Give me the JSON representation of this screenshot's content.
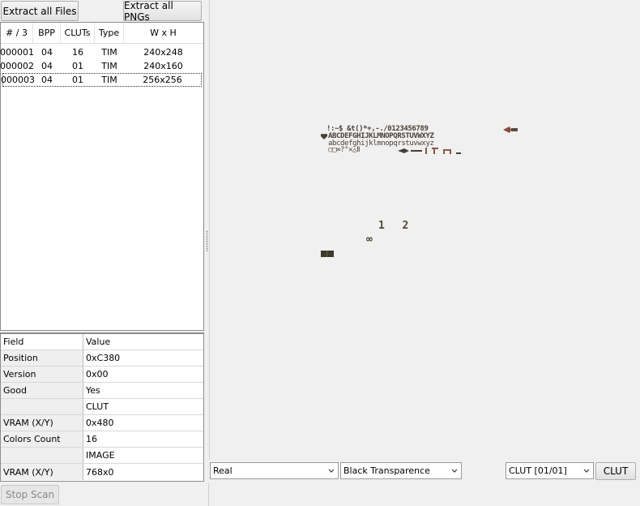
{
  "toolbar": {
    "extract_all_files": "Extract all Files",
    "extract_all_pngs": "Extract all PNGs"
  },
  "file_table": {
    "headers": [
      "# / 3",
      "BPP",
      "CLUTs",
      "Type",
      "W x H"
    ],
    "rows": [
      {
        "id": "000001",
        "bpp": "04",
        "cluts": "16",
        "type": "TIM",
        "size": "240x248"
      },
      {
        "id": "000002",
        "bpp": "04",
        "cluts": "01",
        "type": "TIM",
        "size": "240x160"
      },
      {
        "id": "000003",
        "bpp": "04",
        "cluts": "01",
        "type": "TIM",
        "size": "256x256"
      }
    ],
    "selected_row": 2
  },
  "properties": {
    "headers": [
      "Field",
      "Value"
    ],
    "rows": [
      {
        "field": "Position",
        "value": "0xC380"
      },
      {
        "field": "Version",
        "value": "0x00"
      },
      {
        "field": "Good",
        "value": "Yes"
      },
      {
        "field": "",
        "value": "CLUT"
      },
      {
        "field": "VRAM (X/Y)",
        "value": "0x480"
      },
      {
        "field": "Colors Count",
        "value": "16"
      },
      {
        "field": "",
        "value": "IMAGE"
      },
      {
        "field": "VRAM (X/Y)",
        "value": "768x0"
      }
    ]
  },
  "preview": {
    "font_lines": [
      "!:~$ &t()*+,-./0123456789",
      "ABCDEFGHIJKLMNOPQRSTUVWXYZ",
      "abcdefghijklmnopqrstuvwxyz",
      "○□∞?°✕△Ⅱ"
    ],
    "numbers": "1  2",
    "infinity": "∞",
    "glyph_color": "#4a3f38"
  },
  "controls": {
    "render_mode": "Real",
    "transparency": "Black Transparence",
    "clut_select": "CLUT [01/01]",
    "clut_button": "CLUT"
  },
  "status": {
    "stop_scan": "Stop Scan"
  }
}
